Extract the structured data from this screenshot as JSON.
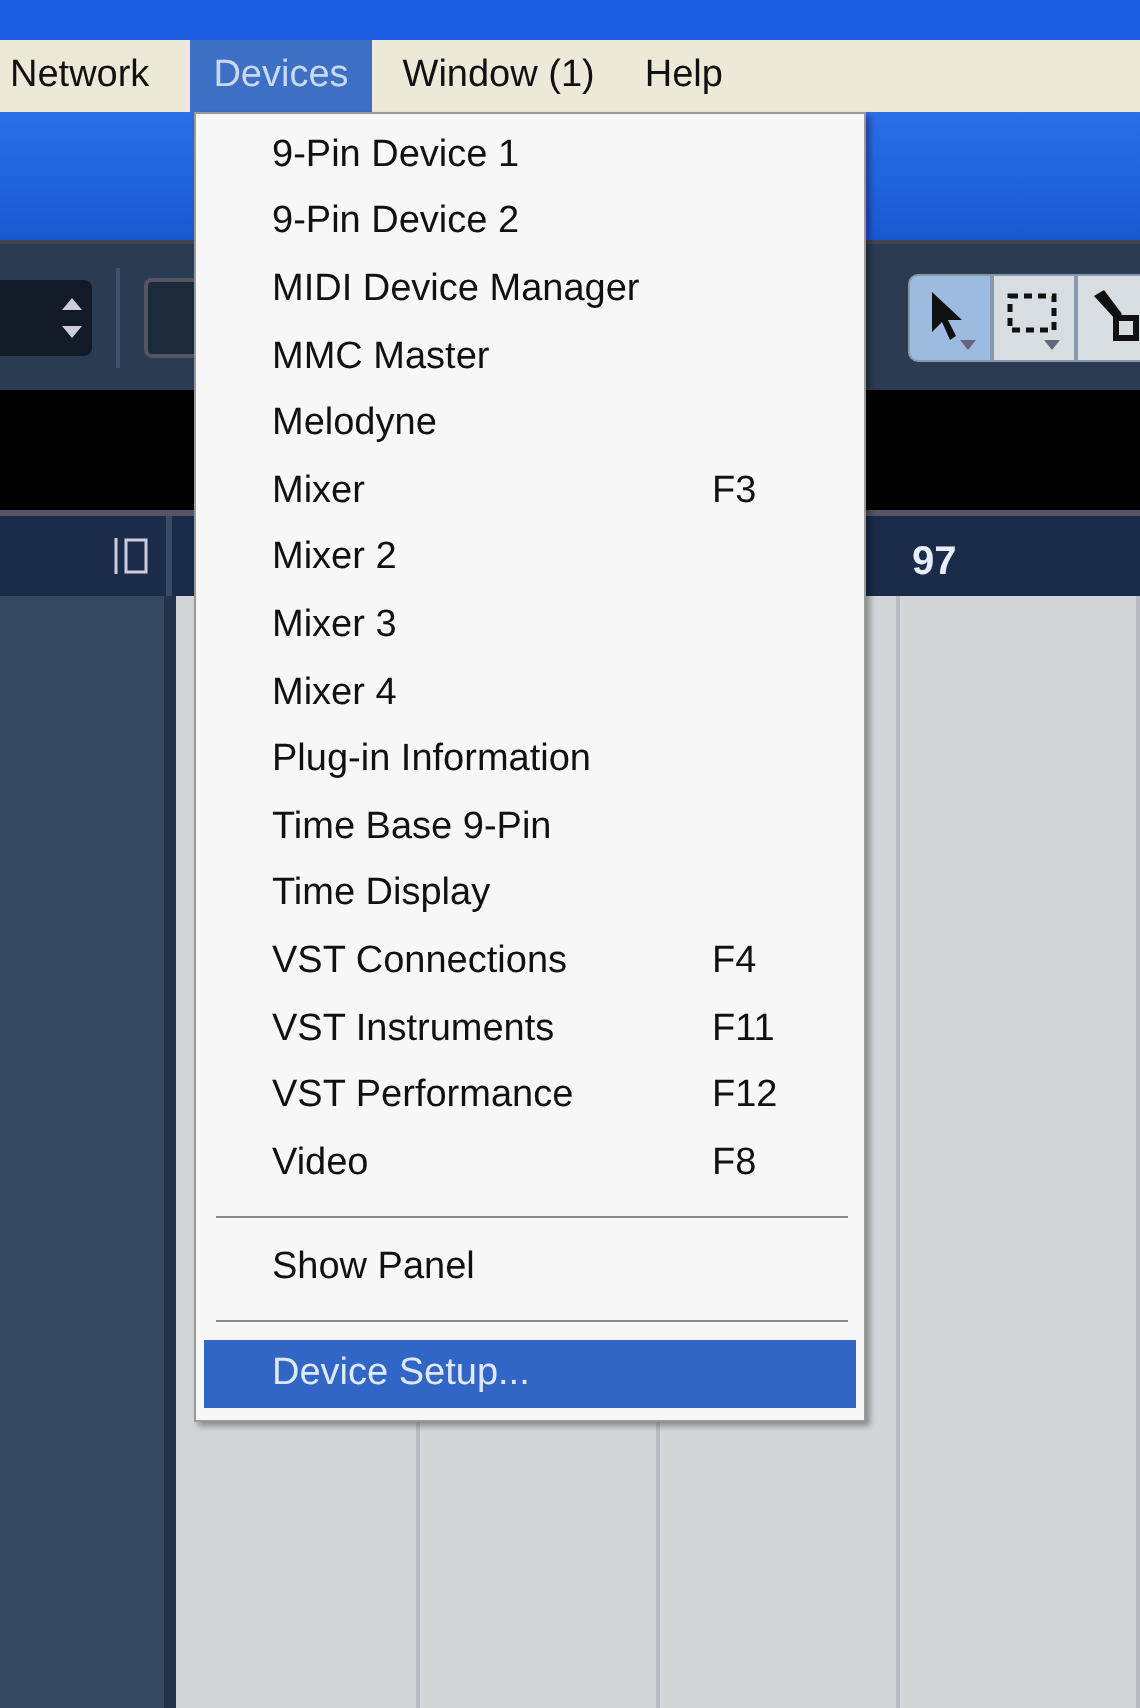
{
  "menubar": [
    {
      "label": "Network",
      "selected": false
    },
    {
      "label": "Devices",
      "selected": true
    },
    {
      "label": "Window (1)",
      "selected": false
    },
    {
      "label": "Help",
      "selected": false
    }
  ],
  "menu": [
    {
      "kind": "item",
      "label": "9-Pin Device 1",
      "selected": false
    },
    {
      "kind": "item",
      "label": "9-Pin Device 2",
      "selected": false
    },
    {
      "kind": "item",
      "label": "MIDI Device Manager",
      "selected": false
    },
    {
      "kind": "item",
      "label": "MMC Master",
      "selected": false
    },
    {
      "kind": "item",
      "label": "Melodyne",
      "selected": false
    },
    {
      "kind": "item",
      "label": "Mixer",
      "shortcut": "F3",
      "selected": false
    },
    {
      "kind": "item",
      "label": "Mixer 2",
      "selected": false
    },
    {
      "kind": "item",
      "label": "Mixer 3",
      "selected": false
    },
    {
      "kind": "item",
      "label": "Mixer 4",
      "selected": false
    },
    {
      "kind": "item",
      "label": "Plug-in Information",
      "selected": false
    },
    {
      "kind": "item",
      "label": "Time Base 9-Pin",
      "selected": false
    },
    {
      "kind": "item",
      "label": "Time Display",
      "selected": false
    },
    {
      "kind": "item",
      "label": "VST Connections",
      "shortcut": "F4",
      "selected": false
    },
    {
      "kind": "item",
      "label": "VST Instruments",
      "shortcut": "F11",
      "selected": false
    },
    {
      "kind": "item",
      "label": "VST Performance",
      "shortcut": "F12",
      "selected": false
    },
    {
      "kind": "item",
      "label": "Video",
      "shortcut": "F8",
      "selected": false
    },
    {
      "kind": "separator"
    },
    {
      "kind": "item",
      "label": "Show Panel",
      "selected": false
    },
    {
      "kind": "separator"
    },
    {
      "kind": "item",
      "label": "Device Setup...",
      "selected": true
    }
  ],
  "tools": [
    {
      "kind": "pointer",
      "selected": true
    },
    {
      "kind": "range",
      "selected": false
    },
    {
      "kind": "glue",
      "selected": false
    }
  ],
  "ruler": {
    "label": "97"
  }
}
